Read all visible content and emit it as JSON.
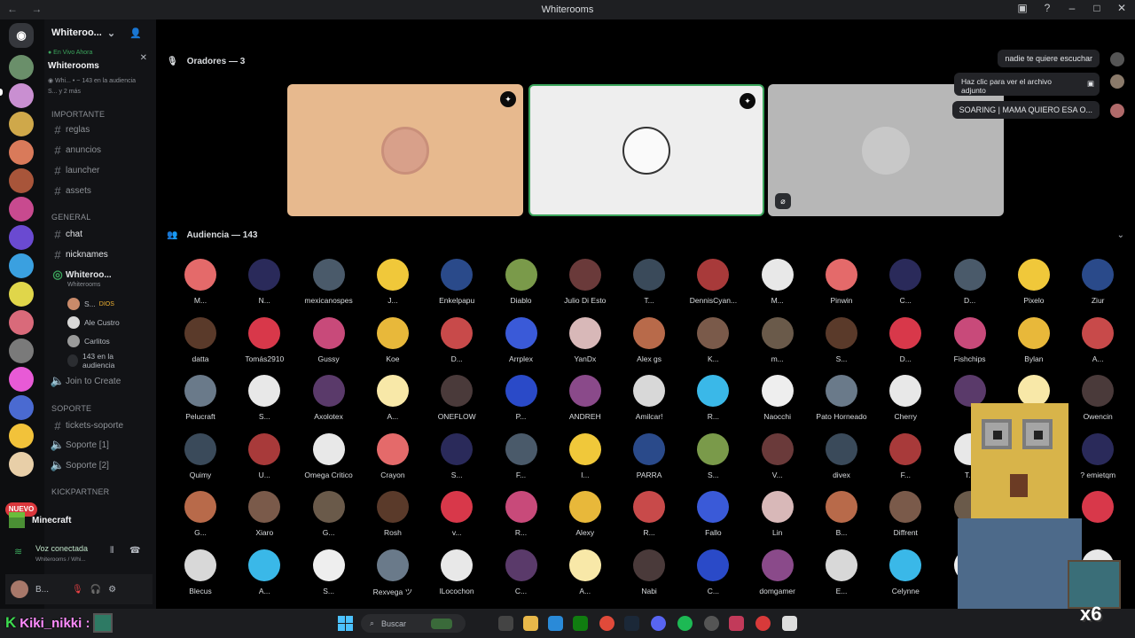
{
  "window": {
    "title": "Whiterooms",
    "nav_arrows": "← →",
    "controls": [
      "▣",
      "?",
      "–",
      "□",
      "✕"
    ]
  },
  "server_rail": {
    "new_badge": "NUEVO"
  },
  "sidebar": {
    "server_name": "Whiteroo...",
    "live_banner": {
      "tag": "● En Vivo Ahora",
      "name": "Whiterooms",
      "subtitle": "◉ Whi... • ~ 143 en la audiencia",
      "avatars_text": "S... y 2 más"
    },
    "categories": {
      "important": "IMPORTANTE",
      "general": "GENERAL",
      "support": "SOPORTE",
      "kick": "KICKPARTNER"
    },
    "channels_important": [
      "reglas",
      "anuncios",
      "launcher",
      "assets"
    ],
    "channels_general": [
      "chat",
      "nicknames"
    ],
    "stage_channel": {
      "name": "Whiteroo...",
      "sub": "Whiterooms",
      "users": [
        "S...",
        "Ale Custro",
        "Carlitos"
      ],
      "user_tags": [
        "DIOS",
        ""
      ],
      "audience": "143 en la audiencia"
    },
    "join_to_create": "Join to Create",
    "channels_support": [
      "tickets-soporte",
      "Soporte [1]",
      "Soporte [2]"
    ]
  },
  "voice_panel": {
    "activity": "Minecraft",
    "status": "Voz conectada",
    "status_sub": "Whiterooms / Whi...",
    "user": "B..."
  },
  "stage": {
    "speakers_title": "Oradores — 3",
    "audience_title": "Audiencia — 143",
    "speaker_colors": [
      "#e7b98e",
      "#eeeeee",
      "#b7b7b7"
    ]
  },
  "notifications": [
    "nadie te quiere escuchar",
    "Haz clic para ver el archivo adjunto",
    "SOARING | MAMA QUIERO ESA O..."
  ],
  "audience": [
    [
      "M...",
      "N...",
      "mexicanospes",
      "J...",
      "Enkelpapu",
      "Diablo",
      "Julio Di Esto",
      "T...",
      "DennisCyan...",
      "M...",
      "Pinwin",
      "C...",
      "D...",
      "Pixelo",
      "Ziur"
    ],
    [
      "datta",
      "Tomás2910",
      "Gussy",
      "Koe",
      "D...",
      "Arrplex",
      "YanDx",
      "Alex gs",
      "K...",
      "m...",
      "S...",
      "D...",
      "Fishchips",
      "Bylan",
      "A..."
    ],
    [
      "Pelucraft",
      "S...",
      "Axolotex",
      "A...",
      "ONEFLOW",
      "P...",
      "ANDREH",
      "Amilcar!",
      "R...",
      "Naocchi",
      "Pato Horneado",
      "Cherry",
      "",
      "",
      "Owencin"
    ],
    [
      "Quimy",
      "U...",
      "Omega Critico",
      "Crayon",
      "S...",
      "F...",
      "I...",
      "PARRA",
      "S...",
      "V...",
      "divex",
      "F...",
      "T...",
      "",
      "? emietqm"
    ],
    [
      "G...",
      "Xiaro",
      "G...",
      "Rosh",
      "v...",
      "R...",
      "Alexy",
      "R...",
      "Fallo",
      "Lin",
      "B...",
      "Diffrent",
      "",
      "",
      ""
    ],
    [
      "Blecus",
      "A...",
      "S...",
      "Rexvega ツ",
      "lLocochon",
      "C...",
      "A...",
      "Nabi",
      "C...",
      "domgamer",
      "E...",
      "Celynne",
      "",
      "",
      ""
    ]
  ],
  "taskbar": {
    "streamer": "Kiki_nikki :",
    "search_placeholder": "Buscar"
  },
  "overlay": {
    "multiplier": "x6"
  }
}
